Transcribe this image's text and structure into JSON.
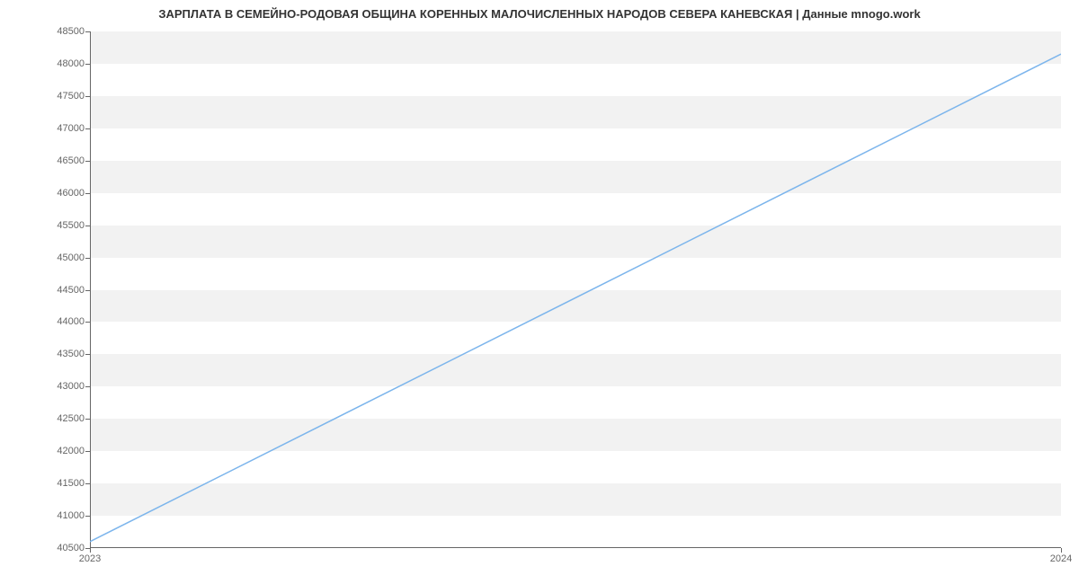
{
  "chart_data": {
    "type": "line",
    "title": "ЗАРПЛАТА В СЕМЕЙНО-РОДОВАЯ ОБЩИНА КОРЕННЫХ МАЛОЧИСЛЕННЫХ НАРОДОВ СЕВЕРА КАНЕВСКАЯ | Данные mnogo.work",
    "xlabel": "",
    "ylabel": "",
    "x": [
      2023,
      2024
    ],
    "values": [
      40600,
      48150
    ],
    "y_ticks": [
      40500,
      41000,
      41500,
      42000,
      42500,
      43000,
      43500,
      44000,
      44500,
      45000,
      45500,
      46000,
      46500,
      47000,
      47500,
      48000,
      48500
    ],
    "x_ticks": [
      2023,
      2024
    ],
    "ylim": [
      40500,
      48500
    ],
    "xlim": [
      2023,
      2024
    ],
    "grid": "banded",
    "line_color": "#7cb5ec"
  }
}
